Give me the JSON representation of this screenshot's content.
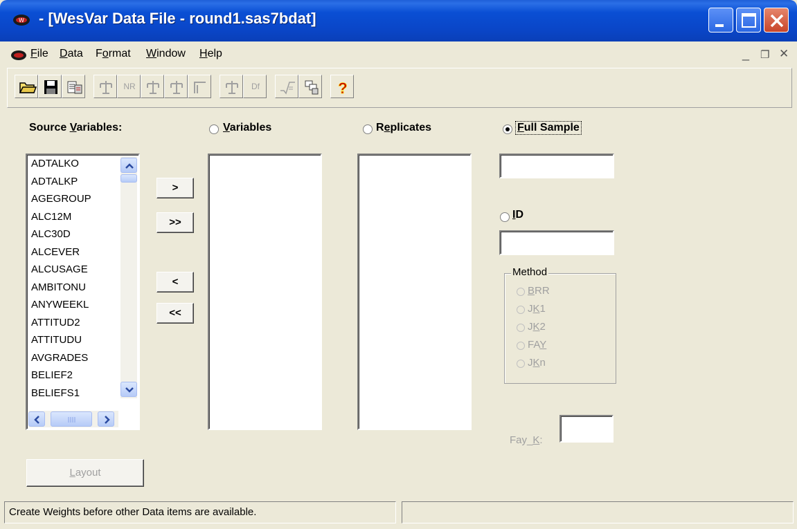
{
  "window": {
    "title": "- [WesVar Data File - round1.sas7bdat]"
  },
  "menu": {
    "items": [
      "File",
      "Data",
      "Format",
      "Window",
      "Help"
    ]
  },
  "toolbar": {
    "nr_label": "NR",
    "df_label": "Df",
    "help_glyph": "?"
  },
  "source": {
    "label_pre": "Source ",
    "label_u": "V",
    "label_post": "ariables:",
    "items": [
      "ADTALKO",
      "ADTALKP",
      "AGEGROUP",
      "ALC12M",
      "ALC30D",
      "ALCEVER",
      "ALCUSAGE",
      "AMBITONU",
      "ANYWEEKL",
      "ATTITUD2",
      "ATTITUDU",
      "AVGRADES",
      "BELIEF2",
      "BELIEFS1"
    ]
  },
  "move_buttons": {
    "add": ">",
    "add_all": ">>",
    "remove": "<",
    "remove_all": "<<"
  },
  "targets": {
    "variables_u": "V",
    "variables_rest": "ariables",
    "replicates_pre": "R",
    "replicates_u": "e",
    "replicates_rest": "plicates",
    "full_sample_u": "F",
    "full_sample_rest": "ull Sample",
    "id_u": "I",
    "id_rest": "D",
    "selected": "Full Sample"
  },
  "method": {
    "title": "Method",
    "options": [
      "BRR",
      "JK1",
      "JK2",
      "FAY",
      "JKn"
    ]
  },
  "fay_k": {
    "label_pre": "Fay_",
    "label_u": "K",
    "label_post": ":",
    "value": ""
  },
  "layout_button": {
    "label_u": "L",
    "label_rest": "ayout"
  },
  "status": {
    "message": "Create Weights before other Data items are available.",
    "secondary": ""
  }
}
